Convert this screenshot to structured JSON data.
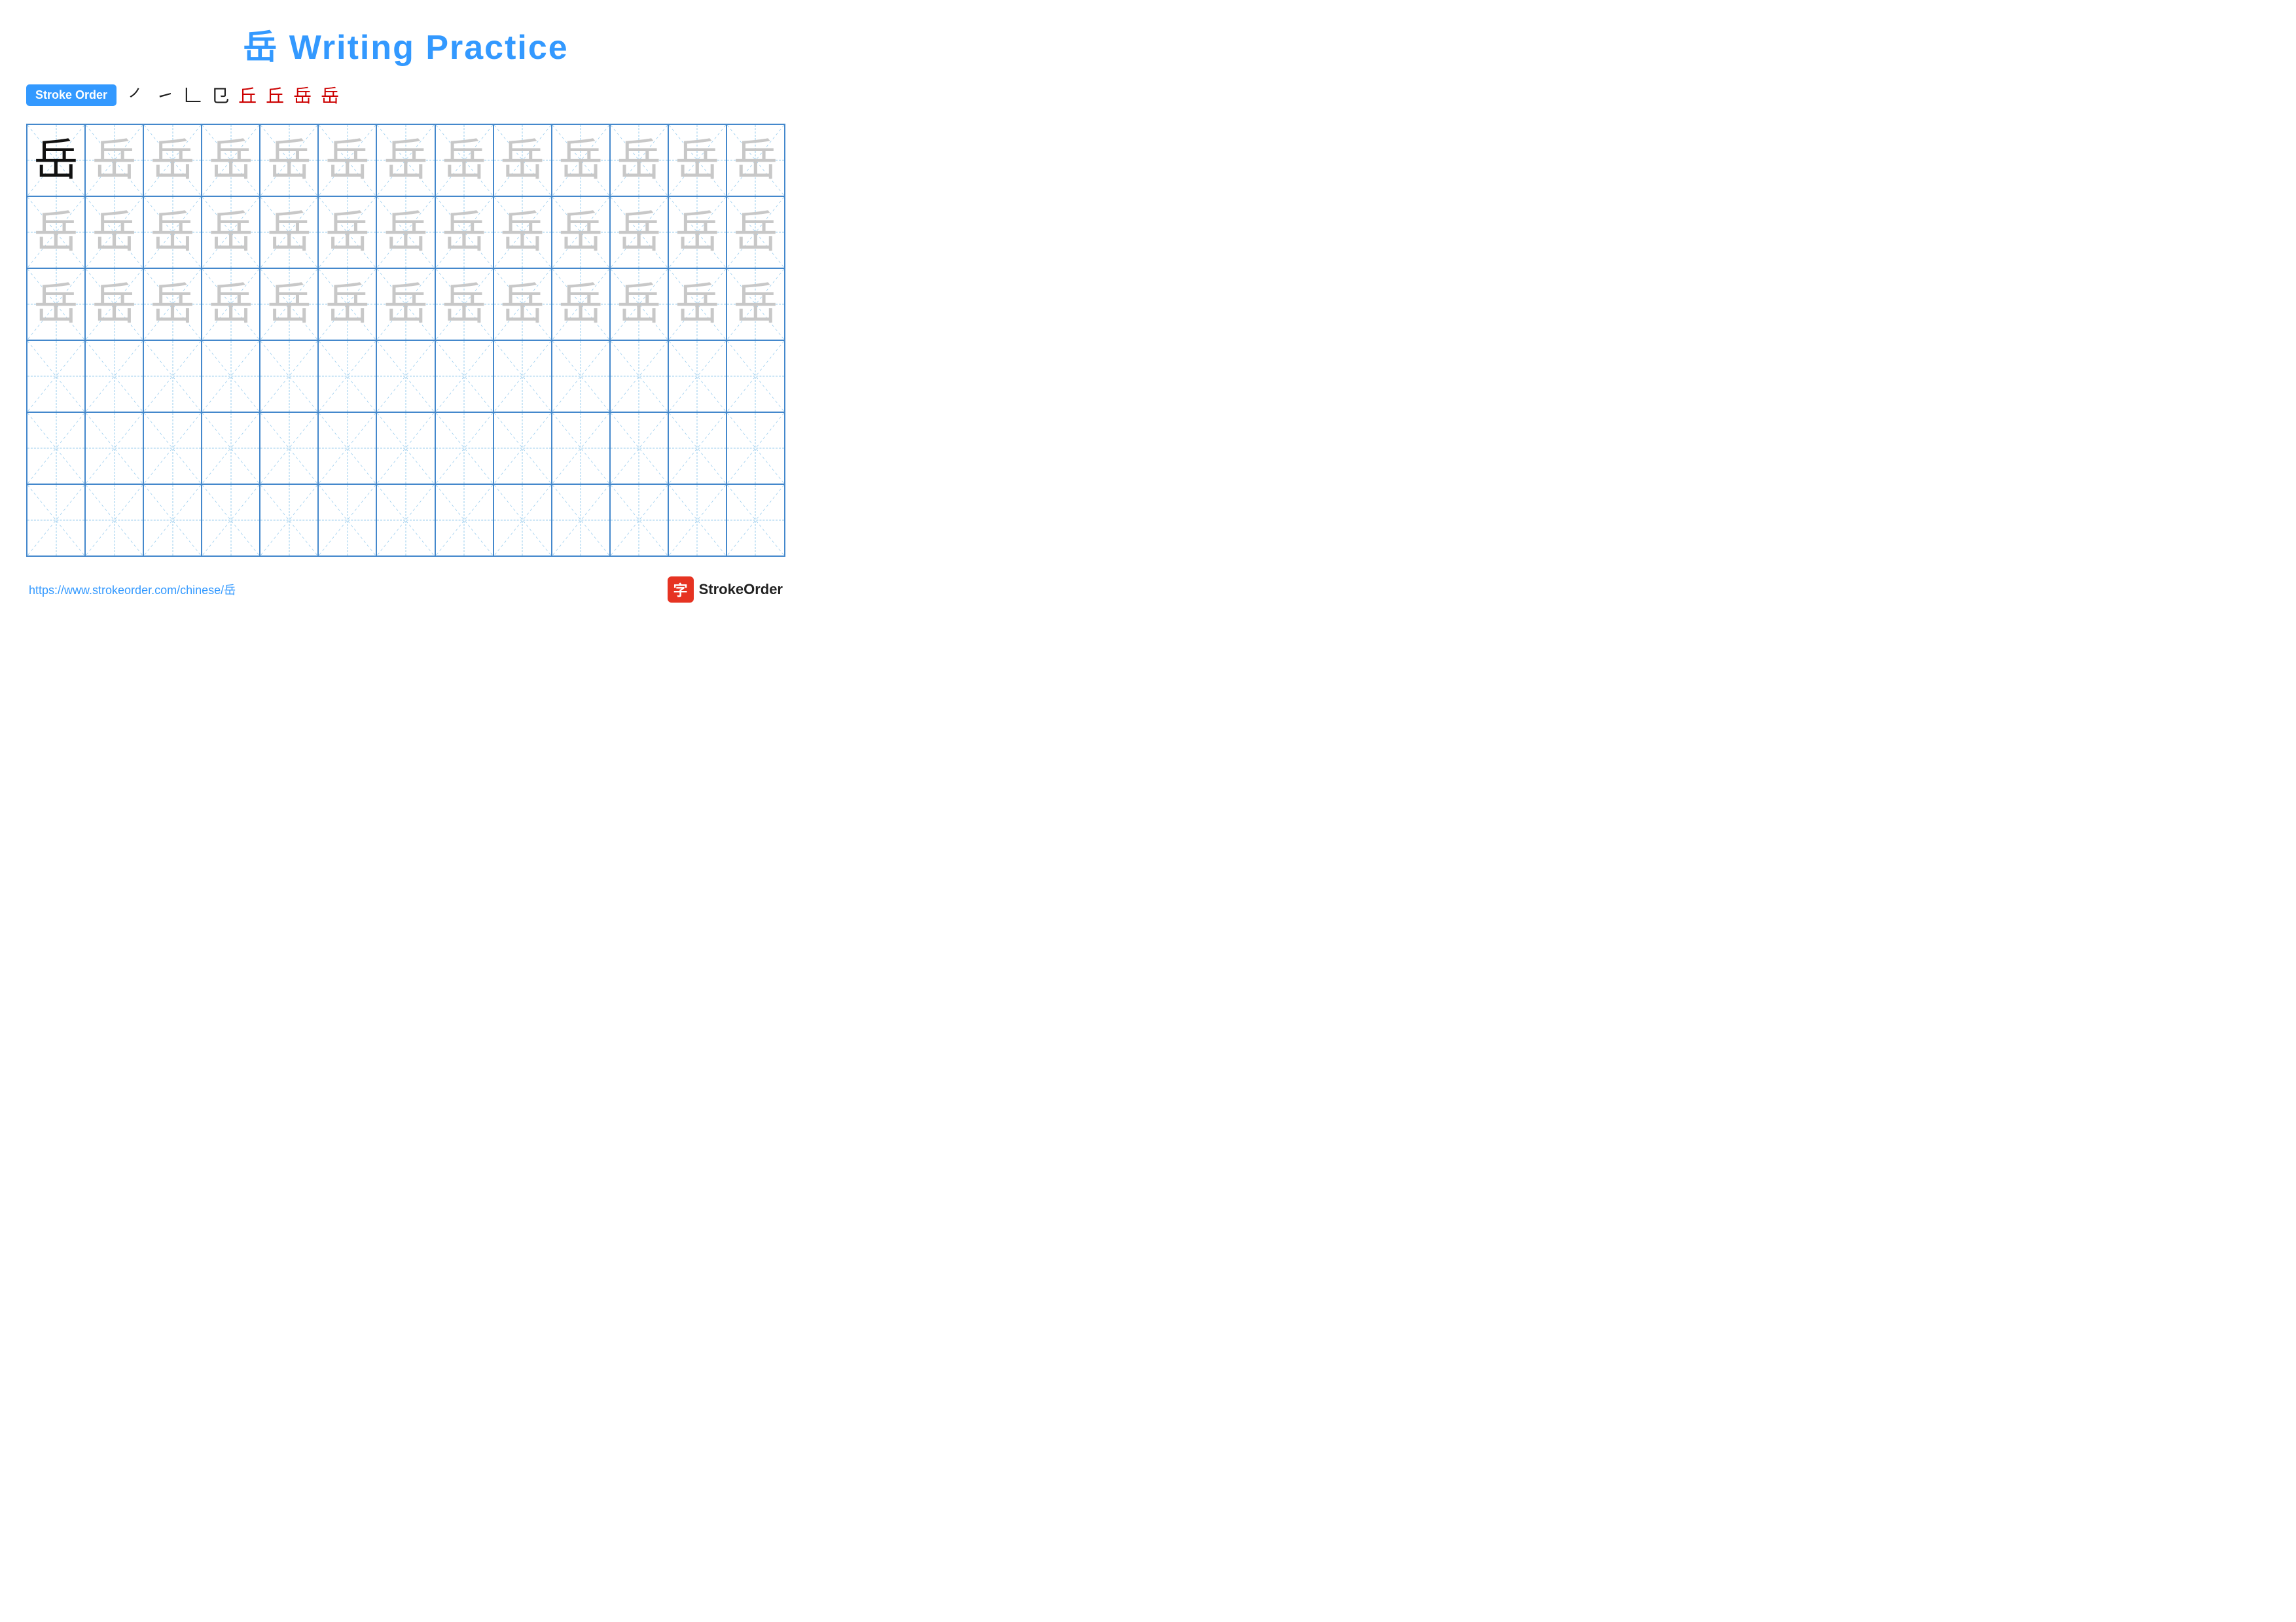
{
  "title": "岳 Writing Practice",
  "stroke_order": {
    "badge_label": "Stroke Order",
    "strokes": [
      {
        "char": "⺃",
        "red": false
      },
      {
        "char": "㇀",
        "red": false
      },
      {
        "char": "𠃊",
        "red": false
      },
      {
        "char": "𠃋",
        "red": false
      },
      {
        "char": "丘",
        "red": true
      },
      {
        "char": "丘",
        "red": true
      },
      {
        "char": "岳",
        "red": true
      },
      {
        "char": "岳",
        "red": true
      }
    ]
  },
  "grid": {
    "rows": 6,
    "cols": 13,
    "cells": [
      "dark",
      "gray",
      "gray",
      "gray",
      "gray",
      "gray",
      "gray",
      "gray",
      "gray",
      "gray",
      "gray",
      "gray",
      "gray",
      "gray",
      "gray",
      "gray",
      "gray",
      "gray",
      "gray",
      "gray",
      "gray",
      "gray",
      "gray",
      "gray",
      "gray",
      "gray",
      "gray",
      "gray",
      "gray",
      "gray",
      "gray",
      "gray",
      "gray",
      "gray",
      "gray",
      "gray",
      "gray",
      "gray",
      "gray",
      "empty",
      "empty",
      "empty",
      "empty",
      "empty",
      "empty",
      "empty",
      "empty",
      "empty",
      "empty",
      "empty",
      "empty",
      "empty",
      "empty",
      "empty",
      "empty",
      "empty",
      "empty",
      "empty",
      "empty",
      "empty",
      "empty",
      "empty",
      "empty",
      "empty",
      "empty",
      "empty",
      "empty",
      "empty",
      "empty",
      "empty",
      "empty",
      "empty",
      "empty",
      "empty",
      "empty",
      "empty",
      "empty",
      "empty"
    ],
    "char": "岳"
  },
  "footer": {
    "url": "https://www.strokeorder.com/chinese/岳",
    "logo_text": "StrokeOrder",
    "logo_char": "字"
  }
}
